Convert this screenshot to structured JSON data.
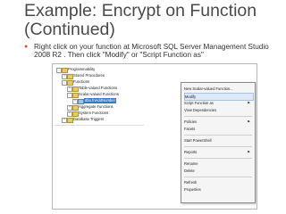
{
  "slide": {
    "title": "Example: Encrypt on Function (Continued)",
    "bullet": "Right click on your function at Microsoft SQL Server Management Studio 2008 R2 . Then click \"Modify\" or \"Script Function as\""
  },
  "tree": {
    "items": [
      {
        "label": "Programmability",
        "expander": "-"
      },
      {
        "label": "Stored Procedures",
        "expander": "+"
      },
      {
        "label": "Functions",
        "expander": "-"
      },
      {
        "label": "Table-valued Functions",
        "expander": "+"
      },
      {
        "label": "Scalar-valued Functions",
        "expander": "-"
      },
      {
        "label": "dbo.fnAddNumber",
        "expander": "+"
      },
      {
        "label": "Aggregate Functions",
        "expander": "+"
      },
      {
        "label": "System Functions",
        "expander": "+"
      },
      {
        "label": "Database Triggers",
        "expander": "+"
      }
    ]
  },
  "context_menu": {
    "items": [
      {
        "label": "New Scalar-valued Function...",
        "submenu": false
      },
      {
        "label": "Modify",
        "submenu": false
      },
      {
        "label": "Script Function as",
        "submenu": true
      },
      {
        "label": "View Dependencies",
        "submenu": false
      },
      {
        "label": "Policies",
        "submenu": true
      },
      {
        "label": "Facets",
        "submenu": false
      },
      {
        "label": "Start PowerShell",
        "submenu": false
      },
      {
        "label": "Reports",
        "submenu": true
      },
      {
        "label": "Rename",
        "submenu": false
      },
      {
        "label": "Delete",
        "submenu": false
      },
      {
        "label": "Refresh",
        "submenu": false
      },
      {
        "label": "Properties",
        "submenu": false
      }
    ]
  },
  "colors": {
    "accent": "#d15a2a",
    "selection": "#3a77c9"
  },
  "icons": {
    "bullet": "bullet-icon",
    "submenu": "submenu-arrow-icon",
    "folder": "folder-icon",
    "function": "function-icon"
  }
}
